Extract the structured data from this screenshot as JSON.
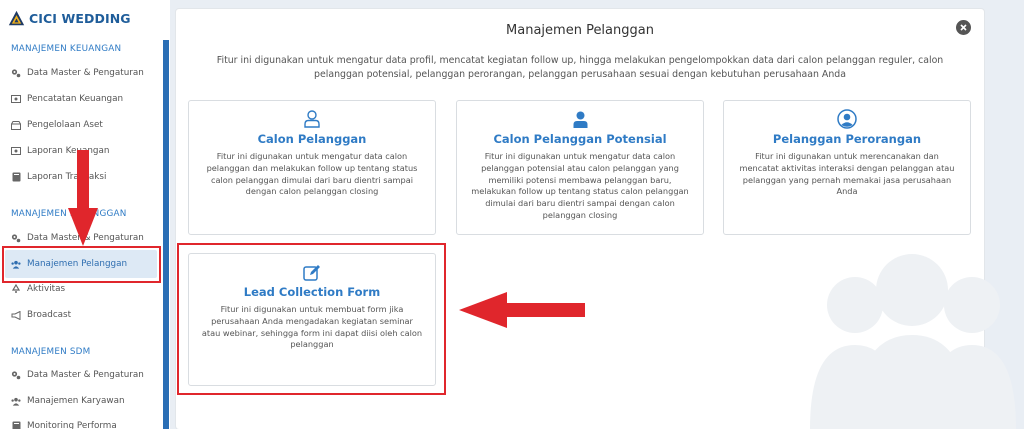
{
  "brand": {
    "title": "CICI WEDDING"
  },
  "sidebar": {
    "sections": [
      {
        "title": "MANAJEMEN KEUANGAN"
      },
      {
        "title": "MANAJEMEN PELANGGAN"
      },
      {
        "title": "MANAJEMEN SDM"
      }
    ],
    "items": [
      {
        "label": "Data Master & Pengaturan",
        "icon": "cogs-icon"
      },
      {
        "label": "Pencatatan Keuangan",
        "icon": "money-icon"
      },
      {
        "label": "Pengelolaan Aset",
        "icon": "box-icon"
      },
      {
        "label": "Laporan Keuangan",
        "icon": "money-icon"
      },
      {
        "label": "Laporan Transaksi",
        "icon": "book-icon"
      },
      {
        "label": "Data Master & Pengaturan",
        "icon": "cogs-icon"
      },
      {
        "label": "Manajemen Pelanggan",
        "icon": "users-icon"
      },
      {
        "label": "Aktivitas",
        "icon": "recycle-icon"
      },
      {
        "label": "Broadcast",
        "icon": "bullhorn-icon"
      },
      {
        "label": "Data Master & Pengaturan",
        "icon": "cogs-icon"
      },
      {
        "label": "Manajemen Karyawan",
        "icon": "users-icon"
      },
      {
        "label": "Monitoring Performa",
        "icon": "book-icon"
      }
    ]
  },
  "panel": {
    "title": "Manajemen Pelanggan",
    "description": "Fitur ini digunakan untuk mengatur data profil, mencatat kegiatan follow up, hingga melakukan pengelompokkan data dari calon pelanggan reguler, calon pelanggan potensial, pelanggan perorangan, pelanggan perusahaan sesuai dengan kebutuhan perusahaan Anda"
  },
  "cards": [
    {
      "title": "Calon Pelanggan",
      "icon": "user-outline-icon",
      "description": "Fitur ini digunakan untuk mengatur data calon pelanggan dan melakukan follow up tentang status calon pelanggan dimulai dari baru dientri sampai dengan calon pelanggan closing"
    },
    {
      "title": "Calon Pelanggan Potensial",
      "icon": "user-solid-icon",
      "description": "Fitur ini digunakan untuk mengatur data calon pelanggan potensial atau calon pelanggan yang memiliki potensi membawa pelanggan baru, melakukan follow up tentang status calon pelanggan dimulai dari baru dientri sampai dengan calon pelanggan closing"
    },
    {
      "title": "Pelanggan Perorangan",
      "icon": "user-circle-icon",
      "description": "Fitur ini digunakan untuk merencanakan dan mencatat aktivitas interaksi dengan pelanggan atau pelanggan yang pernah memakai jasa perusahaan Anda"
    },
    {
      "title": "Lead Collection Form",
      "icon": "edit-icon",
      "description": "Fitur ini digunakan untuk membuat form jika perusahaan Anda mengadakan kegiatan seminar atau webinar, sehingga form ini dapat diisi oleh calon pelanggan"
    }
  ],
  "colors": {
    "accent": "#2f7bc5",
    "annotation": "#e0262c",
    "sidebar_scrollbar": "#2a6eb5"
  }
}
